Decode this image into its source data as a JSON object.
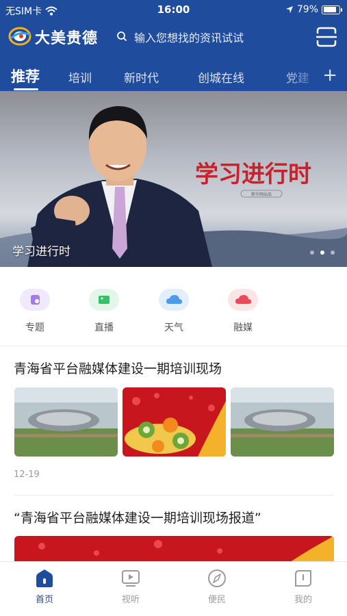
{
  "status_bar": {
    "carrier": "无SIM卡",
    "time": "16:00",
    "battery": "79%"
  },
  "header": {
    "brand": "大美贵德",
    "search_placeholder": "输入您想找的资讯试试",
    "colors": {
      "primary": "#1f4c9c"
    }
  },
  "tabs": [
    {
      "label": "推荐",
      "active": true
    },
    {
      "label": "培训"
    },
    {
      "label": "新时代"
    },
    {
      "label": "创城在线"
    },
    {
      "label": "党建"
    }
  ],
  "tab_add": "+",
  "banner": {
    "caption": "学习进行时",
    "overlay_title": "学习进行时",
    "overlay_sub": "新华网出品",
    "slides": 3,
    "active_slide": 2
  },
  "quick_entries": [
    {
      "label": "专题",
      "icon": "topic-icon"
    },
    {
      "label": "直播",
      "icon": "live-icon"
    },
    {
      "label": "天气",
      "icon": "weather-icon"
    },
    {
      "label": "融媒",
      "icon": "media-icon"
    }
  ],
  "news": [
    {
      "title": "青海省平台融媒体建设一期培训现场",
      "date": "12-19"
    },
    {
      "title": "“青海省平台融媒体建设一期培训现场报道”"
    }
  ],
  "bottom_nav": [
    {
      "label": "首页",
      "icon": "home-icon",
      "active": true
    },
    {
      "label": "视听",
      "icon": "video-icon"
    },
    {
      "label": "便民",
      "icon": "compass-icon"
    },
    {
      "label": "我的",
      "icon": "profile-icon"
    }
  ]
}
